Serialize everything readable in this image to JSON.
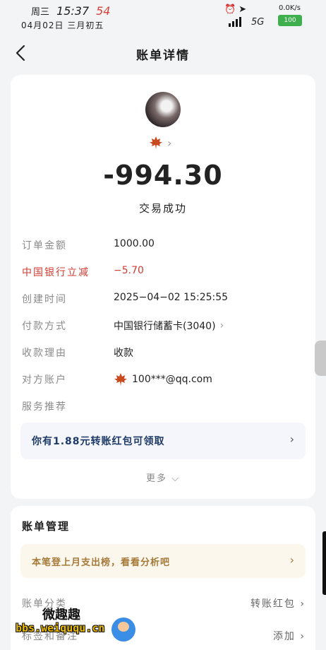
{
  "status_bar": {
    "day": "周三",
    "time": "15:37",
    "temperature": "54",
    "date": "04月02日",
    "lunar_date": "三月初五",
    "network_speed": "0.0K/s",
    "network_type": "5G",
    "battery": "100"
  },
  "nav": {
    "title": "账单详情"
  },
  "transaction": {
    "amount": "-994.30",
    "status": "交易成功"
  },
  "details": [
    {
      "label": "订单金额",
      "value": "1000.00"
    },
    {
      "label": "中国银行立减",
      "value": "−5.70"
    },
    {
      "label": "创建时间",
      "value": "2025−04−02  15:25:55"
    },
    {
      "label": "付款方式",
      "value": "中国银行储蓄卡(3040)"
    },
    {
      "label": "收款理由",
      "value": "收款"
    },
    {
      "label": "对方账户",
      "value": "100***@qq.com"
    },
    {
      "label": "服务推荐",
      "value": ""
    }
  ],
  "banner": {
    "text": "你有1.88元转账红包可领取"
  },
  "more_label": "更多",
  "manage": {
    "title": "账单管理",
    "tip": "本笔登上月支出榜，看看分析吧",
    "rows": [
      {
        "label": "账单分类",
        "value": "转账红包"
      },
      {
        "label": "标签和备注",
        "value": "添加"
      }
    ]
  },
  "watermark": {
    "title": "微趣趣",
    "url": "bbs.weiququ.cn"
  },
  "colors": {
    "accent_red": "#d13b31",
    "banner_text": "#1e3a66",
    "tip_text": "#a57a3a",
    "battery_green": "#3fae4d"
  }
}
